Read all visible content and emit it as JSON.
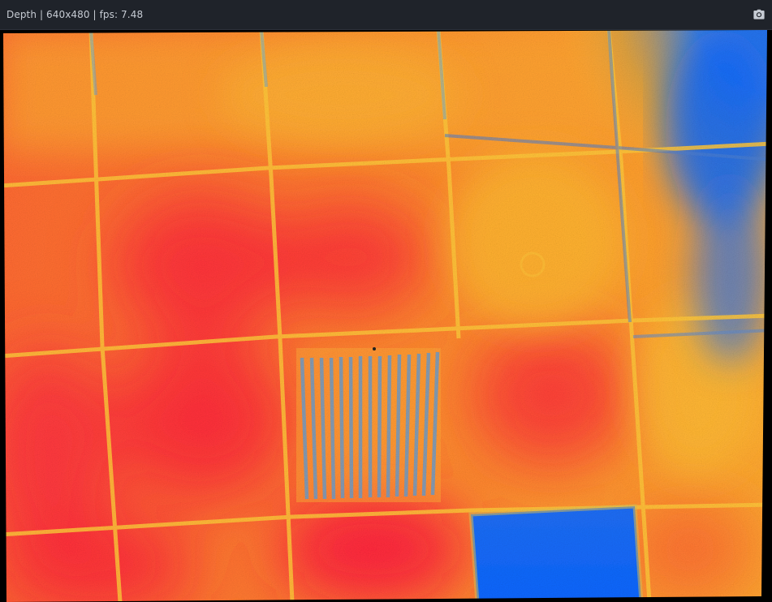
{
  "window": {
    "title": "Depth | 640x480 | fps: 7.48",
    "snapshot_icon": "camera-icon"
  },
  "stream": {
    "stream_type": "Depth",
    "resolution": "640x480",
    "fps": "7.48",
    "colormap": [
      "#0068ff",
      "#ffc233",
      "#ff9a2a",
      "#ff2d3a"
    ]
  }
}
